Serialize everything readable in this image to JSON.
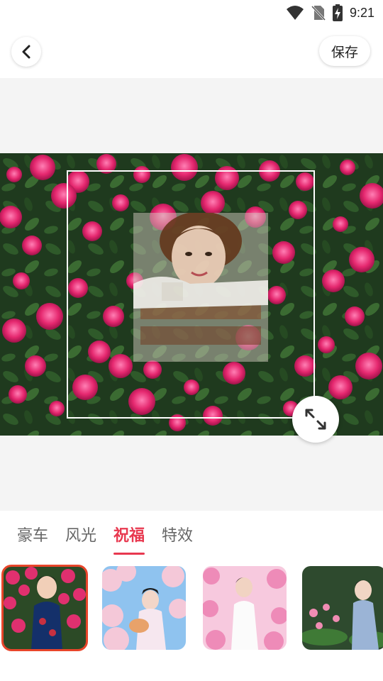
{
  "status_bar": {
    "time": "9:21",
    "icons": [
      "wifi-icon",
      "no-sim-icon",
      "battery-charging-icon"
    ]
  },
  "header": {
    "back_icon": "chevron-left-icon",
    "save_label": "保存"
  },
  "editor": {
    "resize_icon": "expand-arrows-icon"
  },
  "tabs": [
    {
      "label": "豪车",
      "active": false
    },
    {
      "label": "风光",
      "active": false
    },
    {
      "label": "祝福",
      "active": true
    },
    {
      "label": "特效",
      "active": false
    }
  ],
  "templates": [
    {
      "name": "rose-qipao",
      "selected": true
    },
    {
      "name": "cherry-blossom-hanfu",
      "selected": false
    },
    {
      "name": "pink-flower-qipao",
      "selected": false
    },
    {
      "name": "lotus-hanfu",
      "selected": false
    }
  ],
  "colors": {
    "accent": "#e8384f",
    "selected_outline": "#e8452a",
    "canvas_bg": "#f4f4f4"
  }
}
